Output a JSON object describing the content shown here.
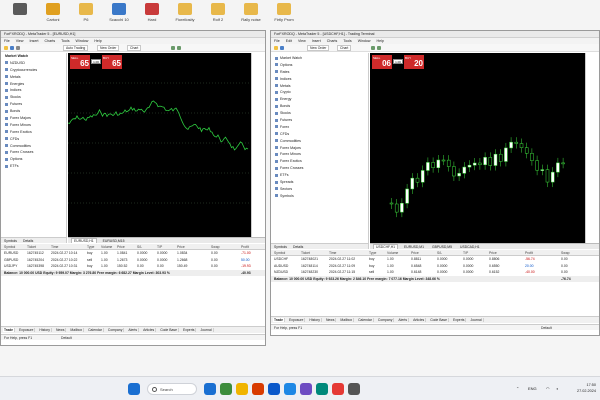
{
  "desktop": {
    "icons": [
      {
        "label": "",
        "color": "#5a5a5a"
      },
      {
        "label": "Cartoni",
        "color": "#e0a020"
      },
      {
        "label": "P6",
        "color": "#e8b84a"
      },
      {
        "label": "Scacchi 10",
        "color": "#3a78c8"
      },
      {
        "label": "Hard",
        "color": "#c83a3a"
      },
      {
        "label": "Fiorellosity",
        "color": "#e8b84a"
      },
      {
        "label": "Rolf 2",
        "color": "#e8b84a"
      },
      {
        "label": "Rally noise",
        "color": "#e8b84a"
      },
      {
        "label": "Firtly Prom",
        "color": "#e8b84a"
      }
    ]
  },
  "left_window": {
    "title": "ForFXRODQ - MetaTrader 5 - [EURUSD,H1]",
    "menu": [
      "File",
      "View",
      "Insert",
      "Charts",
      "Tools",
      "Window",
      "Help"
    ],
    "toolbar": {
      "algo_label": "Auto Trading",
      "new_order_label": "New Order",
      "chart_label": "Chart"
    },
    "sidebar": {
      "header": "Market Watch",
      "items": [
        "NZDUSD",
        "Cryptocurrencies",
        "Metals",
        "Energies",
        "Indices",
        "Stocks",
        "Futures",
        "Bonds",
        "Forex Majors",
        "Forex Minors",
        "Forex Exotics",
        "CFDs",
        "Commodities",
        "Forex Crosses",
        "Options",
        "ETFs"
      ],
      "tabs": [
        "Symbols",
        "Details"
      ]
    },
    "one_click": {
      "sell_label": "SELL",
      "buy_label": "BUY",
      "sell_price": "65",
      "buy_price": "65",
      "lot": "1.00"
    },
    "chart_tabs": [
      "EURUSD,H1",
      "EURUSD,M15"
    ],
    "table": {
      "headers": [
        "Symbol",
        "Ticket",
        "Time",
        "Type",
        "Volume",
        "Price",
        "S/L",
        "T/P",
        "Price",
        "Swap",
        "Profit"
      ],
      "rows": [
        {
          "cells": [
            "EURUSD",
            "162745112",
            "2024.02.27 10:14",
            "buy",
            "1.00",
            "1.0841",
            "0.0000",
            "0.0000",
            "1.0834",
            "0.00",
            "-71.00"
          ],
          "profit_sign": "neg"
        },
        {
          "cells": [
            "GBPUSD",
            "162745204",
            "2024.02.27 10:22",
            "sell",
            "1.00",
            "1.2673",
            "0.0000",
            "0.0000",
            "1.2668",
            "0.00",
            "50.00"
          ],
          "profit_sign": "pos"
        },
        {
          "cells": [
            "USDJPY",
            "162745398",
            "2024.02.27 10:31",
            "buy",
            "1.00",
            "150.52",
            "0.00",
            "0.00",
            "150.49",
            "0.00",
            "-19.93"
          ],
          "profit_sign": "neg"
        }
      ],
      "balance": "Balance: 10 000.00 USD  Equity: 9 959.07  Margin: 3 276.80  Free margin: 6 682.27  Margin Level: 303.93 %",
      "balance_value": "-40.93"
    },
    "bottom_tabs": [
      "Trade",
      "Exposure",
      "History",
      "News",
      "Mailbox",
      "Calendar",
      "Company",
      "Alerts",
      "Articles",
      "Code Base",
      "Experts",
      "Journal"
    ],
    "status_left": "For Help, press F1",
    "status_mid": "Default"
  },
  "right_window": {
    "title": "ForFXRODQ - MetaTrader 5 - [USDCHF,H1] - Trading Terminal",
    "menu": [
      "File",
      "Edit",
      "View",
      "Insert",
      "Charts",
      "Tools",
      "Window",
      "Help"
    ],
    "toolbar": {
      "new_order_label": "New Order",
      "chart_label": "Chart"
    },
    "sidebar": {
      "items": [
        "Market Watch",
        "Options",
        "Rates",
        "Indices",
        "Metals",
        "Crypto",
        "Energy",
        "Bonds",
        "Stocks",
        "Futures",
        "Forex",
        "CFDs",
        "Commodities",
        "Forex Majors",
        "Forex Minors",
        "Forex Exotics",
        "Forex Crosses",
        "ETFs",
        "Spreads",
        "Sectors",
        "Symbols"
      ],
      "tabs": [
        "Symbols",
        "Details"
      ]
    },
    "one_click": {
      "sell_label": "SELL",
      "buy_label": "BUY",
      "sell_price": "06",
      "buy_price": "20",
      "lot": "1.00"
    },
    "chart_tabs": [
      "USDCHF,H1",
      "EURUSD,M1",
      "GBPUSD,M5",
      "USDCAD,H1"
    ],
    "table": {
      "headers": [
        "Symbol",
        "Ticket",
        "Time",
        "Type",
        "Volume",
        "Price",
        "S/L",
        "T/P",
        "Price",
        "Profit",
        "Swap"
      ],
      "rows": [
        {
          "cells": [
            "USDCHF",
            "162748021",
            "2024.02.27 11:02",
            "buy",
            "1.00",
            "0.8811",
            "0.0000",
            "0.0000",
            "0.8806",
            "-56.74",
            "0.00"
          ],
          "profit_sign": "neg"
        },
        {
          "cells": [
            "AUDUSD",
            "162748114",
            "2024.02.27 11:09",
            "buy",
            "1.00",
            "0.6548",
            "0.0000",
            "0.0000",
            "0.6550",
            "20.00",
            "0.00"
          ],
          "profit_sign": "pos"
        },
        {
          "cells": [
            "NZDUSD",
            "162748230",
            "2024.02.27 11:15",
            "sell",
            "1.00",
            "0.6148",
            "0.0000",
            "0.0000",
            "0.6152",
            "-40.00",
            "0.00"
          ],
          "profit_sign": "neg"
        }
      ],
      "balance": "Balance: 10 000.00 USD  Equity: 9 923.26  Margin: 2 846.10  Free margin: 7 077.16  Margin Level: 348.66 %",
      "balance_value": "-76.74"
    },
    "bottom_tabs": [
      "Trade",
      "Exposure",
      "History",
      "News",
      "Mailbox",
      "Calendar",
      "Company",
      "Alerts",
      "Articles",
      "Code Base",
      "Experts",
      "Journal"
    ],
    "status_left": "For Help, press F1",
    "status_right": "Default"
  },
  "taskbar": {
    "search_placeholder": "Search",
    "tray_lang": "ENG",
    "time": "17:50",
    "date": "27.02.2024",
    "icon_colors": [
      "#1a6fd1",
      "#3c8c3c",
      "#f0b400",
      "#d83b01",
      "#0a58ca",
      "#1e88e5",
      "#6d4cc2",
      "#00897b",
      "#e53935",
      "#555555"
    ]
  }
}
